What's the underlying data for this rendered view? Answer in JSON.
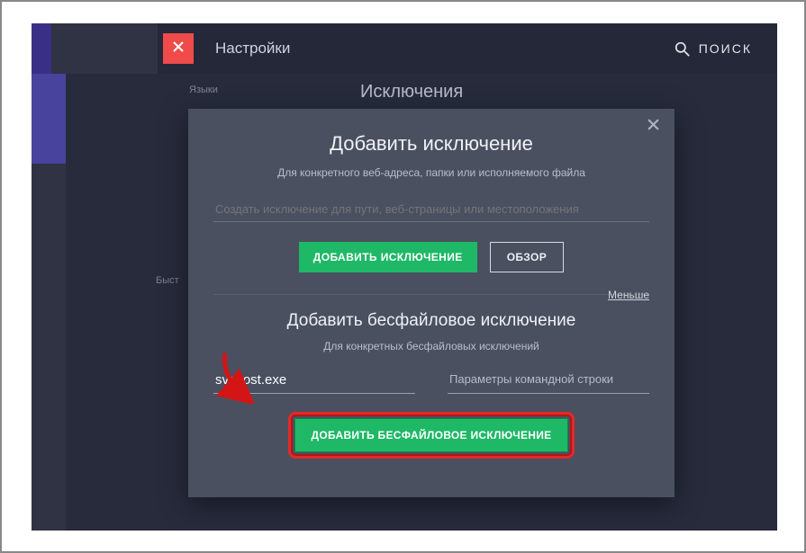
{
  "header": {
    "page_title": "Настройки",
    "search_label": "ПОИСК"
  },
  "background": {
    "sidebar_section": "Языки",
    "content_heading": "Исключения",
    "quick_label": "Быст"
  },
  "modal": {
    "title1": "Добавить исключение",
    "subtitle1": "Для конкретного веб-адреса, папки или исполняемого файла",
    "path_placeholder": "Создать исключение для пути, веб-страницы или местоположения",
    "add_exception_btn": "ДОБАВИТЬ ИСКЛЮЧЕНИЕ",
    "browse_btn": "ОБЗОР",
    "less_link": "Меньше",
    "title2": "Добавить бесфайловое исключение",
    "subtitle2": "Для конкретных бесфайловых исключений",
    "file_value": "svchost.exe",
    "cmdline_placeholder": "Параметры командной строки",
    "add_fileless_btn": "ДОБАВИТЬ БЕСФАЙЛОВОЕ ИСКЛЮЧЕНИЕ"
  }
}
